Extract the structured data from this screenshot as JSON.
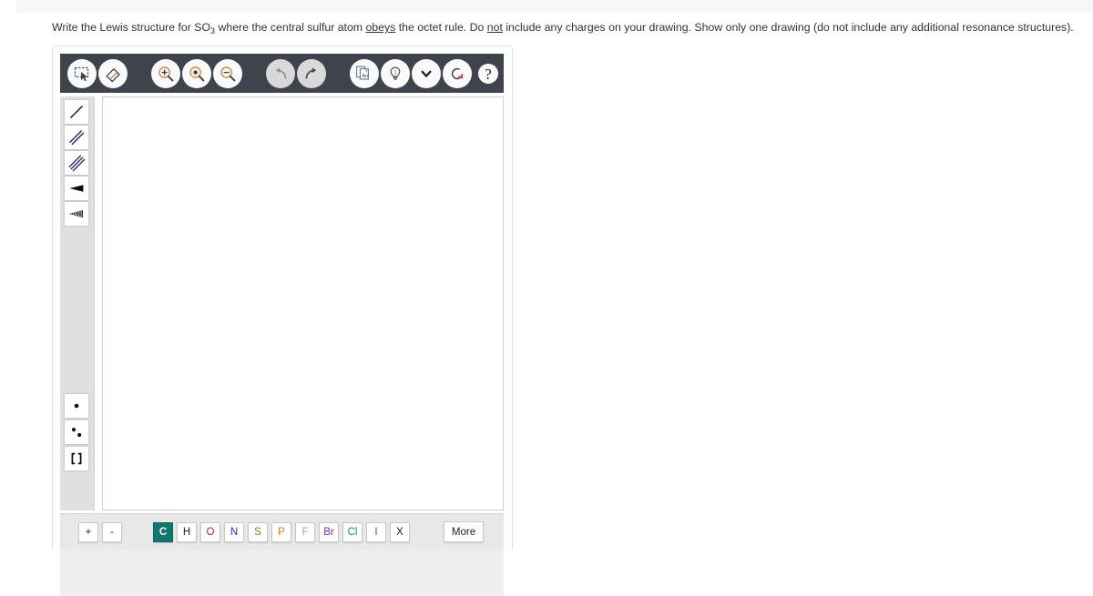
{
  "question": {
    "part1": "Write the Lewis structure for SO",
    "sub": "3",
    "part2": " where the central sulfur atom ",
    "underline1": "obeys",
    "part3": " the octet rule. Do ",
    "underline2": "not",
    "part4": " include any charges on your drawing. Show only one drawing (do not include any additional resonance structures)."
  },
  "toolbar": {
    "buttons": [
      {
        "name": "select-lasso-icon",
        "title": "Select"
      },
      {
        "name": "eraser-icon",
        "title": "Erase"
      },
      {
        "name": "zoom-in-icon",
        "title": "Zoom In"
      },
      {
        "name": "zoom-fit-icon",
        "title": "Zoom to Fit"
      },
      {
        "name": "zoom-out-icon",
        "title": "Zoom Out"
      },
      {
        "name": "undo-icon",
        "title": "Undo"
      },
      {
        "name": "redo-icon",
        "title": "Redo"
      },
      {
        "name": "template-document-icon",
        "title": "Templates"
      },
      {
        "name": "lightbulb-icon",
        "title": "Hint"
      },
      {
        "name": "chevron-down-icon",
        "title": "More Options"
      },
      {
        "name": "reset-refresh-icon",
        "title": "Reset"
      },
      {
        "name": "help-question-icon",
        "title": "Help"
      }
    ],
    "template_icon_label": "An"
  },
  "palette": {
    "top_tools": [
      {
        "name": "single-bond-tool",
        "label": "Single Bond"
      },
      {
        "name": "double-bond-tool",
        "label": "Double Bond"
      },
      {
        "name": "triple-bond-tool",
        "label": "Triple Bond"
      },
      {
        "name": "wedge-bond-tool",
        "label": "Wedge Bond"
      },
      {
        "name": "hash-bond-tool",
        "label": "Hash Bond"
      }
    ],
    "bottom_tools": [
      {
        "name": "single-electron-tool",
        "label": "Single Electron"
      },
      {
        "name": "lone-pair-tool",
        "label": "Lone Pair"
      },
      {
        "name": "brackets-tool",
        "label": "Brackets"
      }
    ]
  },
  "element_bar": {
    "charges": [
      {
        "label": "+",
        "name": "increase-charge-button"
      },
      {
        "label": "-",
        "name": "decrease-charge-button"
      }
    ],
    "elements": [
      {
        "symbol": "C",
        "color": "#ffffff",
        "selected": true
      },
      {
        "symbol": "H",
        "color": "#1a1a1a",
        "selected": false
      },
      {
        "symbol": "O",
        "color": "#e8130f",
        "selected": false
      },
      {
        "symbol": "N",
        "color": "#2b26d8",
        "selected": false
      },
      {
        "symbol": "S",
        "color": "#8b7a1e",
        "selected": false
      },
      {
        "symbol": "P",
        "color": "#d98317",
        "selected": false
      },
      {
        "symbol": "F",
        "color": "#c6a35a",
        "selected": false
      },
      {
        "symbol": "Br",
        "color": "#7b2ea8",
        "selected": false
      },
      {
        "symbol": "Cl",
        "color": "#18a018",
        "selected": false
      },
      {
        "symbol": "I",
        "color": "#8b2fb0",
        "selected": false
      },
      {
        "symbol": "X",
        "color": "#1a1a1a",
        "selected": false
      }
    ],
    "more_label": "More",
    "selected_color": "#11786e"
  },
  "canvas": {
    "content": ""
  }
}
